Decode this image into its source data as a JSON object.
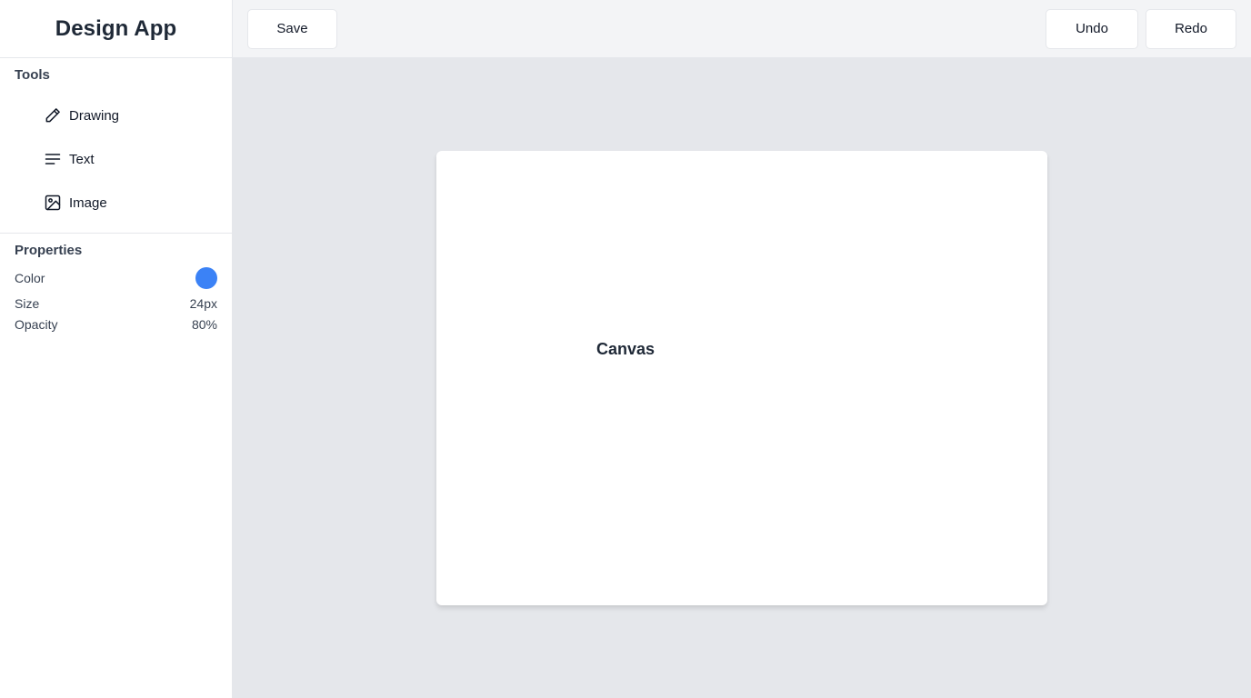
{
  "app": {
    "title": "Design App"
  },
  "toolbar": {
    "save_label": "Save",
    "undo_label": "Undo",
    "redo_label": "Redo"
  },
  "sidebar": {
    "tools_title": "Tools",
    "tools": [
      {
        "label": "Drawing",
        "icon": "pencil-icon"
      },
      {
        "label": "Text",
        "icon": "text-lines-icon"
      },
      {
        "label": "Image",
        "icon": "image-icon"
      }
    ],
    "properties_title": "Properties",
    "properties": {
      "color_label": "Color",
      "color_value": "#3b82f6",
      "size_label": "Size",
      "size_value": "24px",
      "opacity_label": "Opacity",
      "opacity_value": "80%"
    }
  },
  "canvas": {
    "label": "Canvas"
  },
  "colors": {
    "sidebar_bg": "#ffffff",
    "toolbar_bg": "#f3f4f6",
    "workspace_bg": "#e5e7eb",
    "accent": "#3b82f6"
  }
}
